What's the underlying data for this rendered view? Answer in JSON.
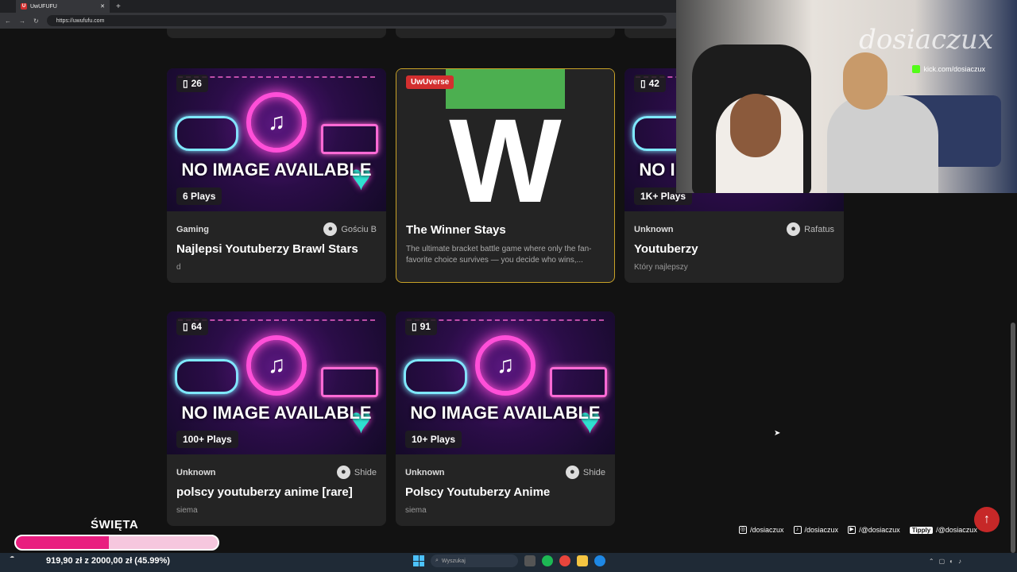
{
  "browser": {
    "tab_title": "UwUFUFU",
    "tab_favicon": "U",
    "url": "https://uwufufu.com"
  },
  "cards": [
    {
      "type": "quiz",
      "count": "26",
      "plays": "6 Plays",
      "category": "Gaming",
      "author": "Gościu B",
      "title": "Najlepsi Youtuberzy Brawl Stars",
      "desc": "d",
      "noimg": "NO IMAGE AVAILABLE"
    },
    {
      "type": "featured",
      "brand": "UwUverse",
      "letter": "W",
      "title": "The Winner Stays",
      "desc": "The ultimate bracket battle game where only the fan-favorite choice survives — you decide who wins,..."
    },
    {
      "type": "quiz",
      "count": "42",
      "plays": "1K+ Plays",
      "category": "Unknown",
      "author": "Rafatus",
      "title": "Youtuberzy",
      "desc": "Który najlepszy",
      "noimg": "NO IMAGE AVAILABLE"
    },
    {
      "type": "quiz",
      "count": "64",
      "plays": "100+ Plays",
      "category": "Unknown",
      "author": "Shide",
      "title": "polscy youtuberzy anime [rare]",
      "desc": "siema",
      "noimg": "NO IMAGE AVAILABLE"
    },
    {
      "type": "quiz",
      "count": "91",
      "plays": "10+ Plays",
      "category": "Unknown",
      "author": "Shide",
      "title": "Polscy Youtuberzy Anime",
      "desc": "siema",
      "noimg": "NO IMAGE AVAILABLE"
    }
  ],
  "stream": {
    "logo": "dosiaczux",
    "kick_label": "kick.com/dosiaczux",
    "socials": [
      {
        "icon": "instagram-icon",
        "label": "/dosiaczux"
      },
      {
        "icon": "tiktok-icon",
        "label": "/dosiaczux"
      },
      {
        "icon": "youtube-icon",
        "label": "/@dosiaczux"
      },
      {
        "icon": "tipply-icon",
        "badge": "Tipply",
        "label": "/@dosiaczux"
      }
    ],
    "goal_title": "ŚWIĘTA",
    "goal_amount": "919,90 zł z 2000,00 zł (45.99%)",
    "goal_progress": 0.4599
  },
  "taskbar": {
    "search_placeholder": "Wyszukaj"
  },
  "colors": {
    "accent": "#d32f2f",
    "featured_border": "#c9a227",
    "goal_fill": "#e91e7f",
    "crown": "#4caf50"
  }
}
